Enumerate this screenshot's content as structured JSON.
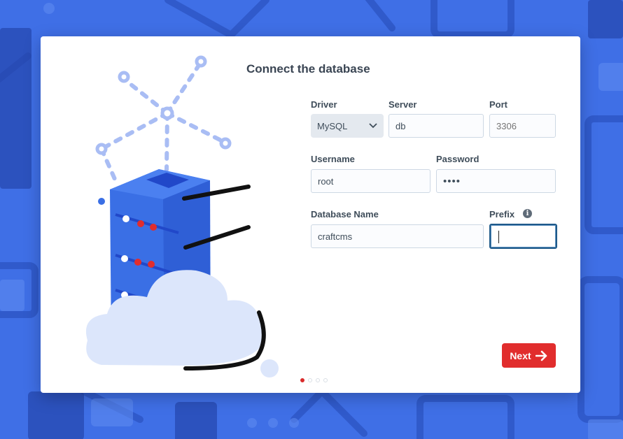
{
  "dialog": {
    "title": "Connect the database"
  },
  "form": {
    "driver": {
      "label": "Driver",
      "value": "MySQL"
    },
    "server": {
      "label": "Server",
      "value": "db"
    },
    "port": {
      "label": "Port",
      "placeholder": "3306"
    },
    "username": {
      "label": "Username",
      "value": "root"
    },
    "password": {
      "label": "Password",
      "value": "••••"
    },
    "database_name": {
      "label": "Database Name",
      "value": "craftcms"
    },
    "prefix": {
      "label": "Prefix",
      "value": "",
      "info_icon": "info-icon"
    }
  },
  "actions": {
    "next_label": "Next",
    "next_icon": "arrow-right-icon"
  },
  "pager": {
    "total": 4,
    "active_index": 0
  },
  "colors": {
    "background": "#3f6fe6",
    "accent": "#e12d2d",
    "focus_border": "#1f5a8a"
  }
}
